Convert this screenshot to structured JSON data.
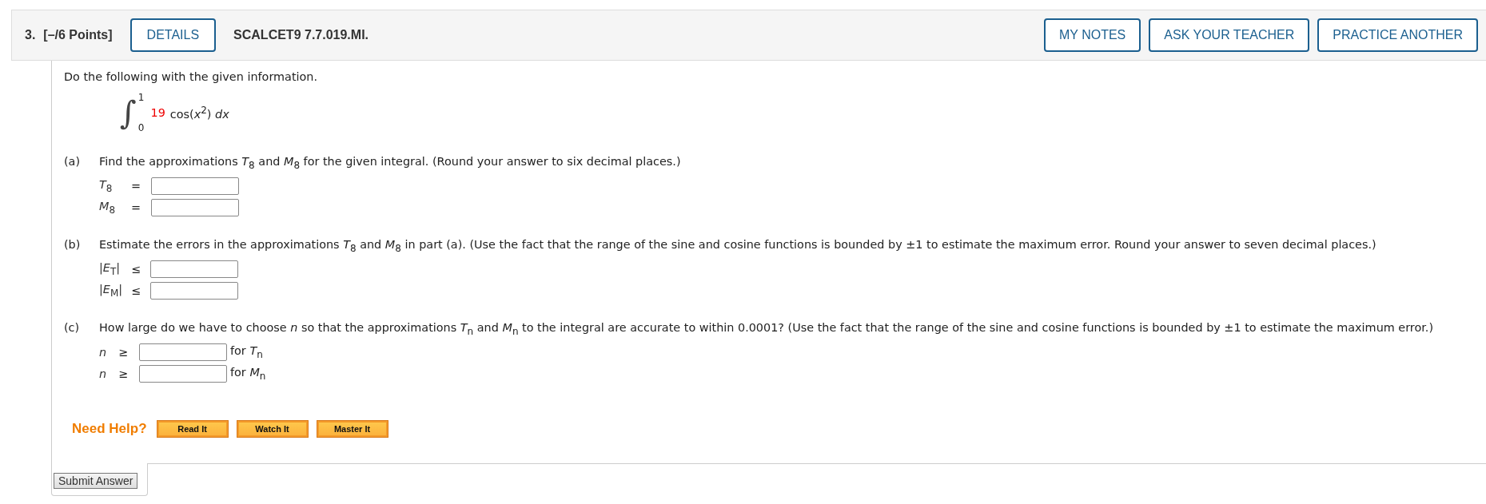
{
  "header": {
    "number": "3.",
    "points": "[–/6 Points]",
    "details_button": "DETAILS",
    "problem_id": "SCALCET9 7.7.019.MI.",
    "buttons": [
      "MY NOTES",
      "ASK YOUR TEACHER",
      "PRACTICE ANOTHER"
    ]
  },
  "instruction": "Do the following with the given information.",
  "integral": {
    "sign": "∫",
    "upper": "1",
    "lower": "0",
    "coefficient": "19",
    "expression": "cos(*x*$^{2}$) *dx*"
  },
  "parts": [
    {
      "label": "(a)",
      "text": "Find the approximations *T*$_{8}$ and *M*$_{8}$ for the given integral. (Round your answer to six decimal places.)",
      "answers": [
        {
          "label": "*T*$_{8}$",
          "relation": "="
        },
        {
          "label": "*M*$_{8}$",
          "relation": "="
        }
      ]
    },
    {
      "label": "(b)",
      "text": "Estimate the errors in the approximations *T*$_{8}$ and *M*$_{8}$ in part (a). (Use the fact that the range of the sine and cosine functions is bounded by ±1 to estimate the maximum error. Round your answer to seven decimal places.)",
      "answers": [
        {
          "label": "|*E*$_{T}$|",
          "relation": "≤"
        },
        {
          "label": "|*E*$_{M}$|",
          "relation": "≤"
        }
      ]
    },
    {
      "label": "(c)",
      "text": "How large do we have to choose *n* so that the approximations *T*$_{n}$ and *M*$_{n}$ to the integral are accurate to within 0.0001? (Use the fact that the range of the sine and cosine functions is bounded by ±1 to estimate the maximum error.)",
      "answers": [
        {
          "label": "*n*",
          "relation": "≥",
          "suffix": "for *T*$_{n}$"
        },
        {
          "label": "*n*",
          "relation": "≥",
          "suffix": "for *M*$_{n}$"
        }
      ]
    }
  ],
  "help": {
    "label": "Need Help?",
    "buttons": [
      "Read It",
      "Watch It",
      "Master It"
    ]
  },
  "submit": "Submit Answer"
}
